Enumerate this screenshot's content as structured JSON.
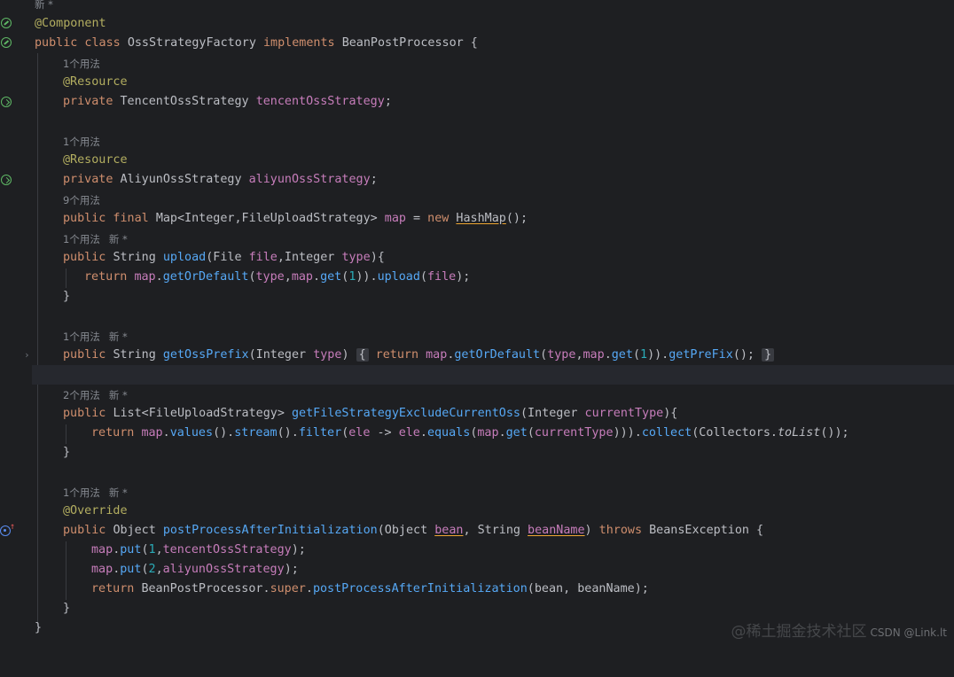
{
  "hints": {
    "top": "新 *",
    "h1": "1个用法",
    "h2": "1个用法",
    "h3": "9个用法",
    "h4": "1个用法",
    "h5": "1个用法",
    "h6": "2个用法",
    "h7": "1个用法",
    "new": "新 *"
  },
  "code": {
    "l1": "@Component",
    "l2a": "public class ",
    "l2b": "OssStrategyFactory ",
    "l2c": "implements ",
    "l2d": "BeanPostProcessor {",
    "l3a": "@Resource",
    "l4a": "private ",
    "l4b": "TencentOssStrategy ",
    "l4c": "tencentOssStrategy",
    "l4d": ";",
    "l5a": "@Resource",
    "l6a": "private ",
    "l6b": "AliyunOssStrategy ",
    "l6c": "aliyunOssStrategy",
    "l6d": ";",
    "l7a": "public final ",
    "l7b": "Map<Integer,FileUploadStrategy> ",
    "l7c": "map",
    "l7d": " = ",
    "l7e": "new ",
    "l7f": "HashMap",
    "l7g": "();",
    "l8a": "public ",
    "l8b": "String ",
    "l8c": "upload",
    "l8d": "(File ",
    "l8e": "file",
    "l8f": ",Integer ",
    "l8g": "type",
    "l8h": "){",
    "l9a": "return ",
    "l9b": "map",
    "l9c": ".",
    "l9d": "getOrDefault",
    "l9e": "(",
    "l9f": "type",
    "l9g": ",",
    "l9h": "map",
    "l9i": ".",
    "l9j": "get",
    "l9k": "(",
    "l9l": "1",
    "l9m": ")).",
    "l9n": "upload",
    "l9o": "(",
    "l9p": "file",
    "l9q": ");",
    "l10": "}",
    "l11a": "public ",
    "l11b": "String ",
    "l11c": "getOssPrefix",
    "l11d": "(Integer ",
    "l11e": "type",
    "l11f": ") ",
    "l11g": "{",
    "l11h": " return ",
    "l11i": "map",
    "l11j": ".",
    "l11k": "getOrDefault",
    "l11l": "(",
    "l11m": "type",
    "l11n": ",",
    "l11o": "map",
    "l11p": ".",
    "l11q": "get",
    "l11r": "(",
    "l11s": "1",
    "l11t": ")).",
    "l11u": "getPreFix",
    "l11v": "(); ",
    "l11w": "}",
    "l12a": "public ",
    "l12b": "List<FileUploadStrategy> ",
    "l12c": "getFileStrategyExcludeCurrentOss",
    "l12d": "(Integer ",
    "l12e": "currentType",
    "l12f": "){",
    "l13a": "return ",
    "l13b": "map",
    "l13c": ".",
    "l13d": "values",
    "l13e": "().",
    "l13f": "stream",
    "l13g": "().",
    "l13h": "filter",
    "l13i": "(",
    "l13j": "ele",
    "l13k": " -> ",
    "l13l": "ele",
    "l13m": ".",
    "l13n": "equals",
    "l13o": "(",
    "l13p": "map",
    "l13q": ".",
    "l13r": "get",
    "l13s": "(",
    "l13t": "currentType",
    "l13u": "))).",
    "l13v": "collect",
    "l13w": "(Collectors.",
    "l13x": "toList",
    "l13y": "());",
    "l14": "}",
    "l15": "@Override",
    "l16a": "public ",
    "l16b": "Object ",
    "l16c": "postProcessAfterInitialization",
    "l16d": "(Object ",
    "l16e": "bean",
    "l16f": ", String ",
    "l16g": "beanName",
    "l16h": ") ",
    "l16i": "throws ",
    "l16j": "BeansException {",
    "l17a": "map",
    "l17b": ".",
    "l17c": "put",
    "l17d": "(",
    "l17e": "1",
    "l17f": ",",
    "l17g": "tencentOssStrategy",
    "l17h": ");",
    "l18a": "map",
    "l18b": ".",
    "l18c": "put",
    "l18d": "(",
    "l18e": "2",
    "l18f": ",",
    "l18g": "aliyunOssStrategy",
    "l18h": ");",
    "l19a": "return ",
    "l19b": "BeanPostProcessor.",
    "l19c": "super",
    "l19d": ".",
    "l19e": "postProcessAfterInitialization",
    "l19f": "(bean, beanName);",
    "l20": "}",
    "l21": "}"
  },
  "gutter_icons": [
    "bean-icon",
    "bean-icon",
    "inject-icon",
    "inject-icon",
    "override-icon"
  ],
  "watermark": {
    "site": "@稀土掘金技术社区",
    "text": "CSDN @Link.lt"
  },
  "colors": {
    "background": "#1e1f22",
    "keyword": "#cf8e6d",
    "annotation": "#b3ae60",
    "field": "#c77dbb",
    "method": "#56a8f5",
    "number": "#2aacb8",
    "text": "#bcbec4",
    "hint": "#868a91"
  }
}
